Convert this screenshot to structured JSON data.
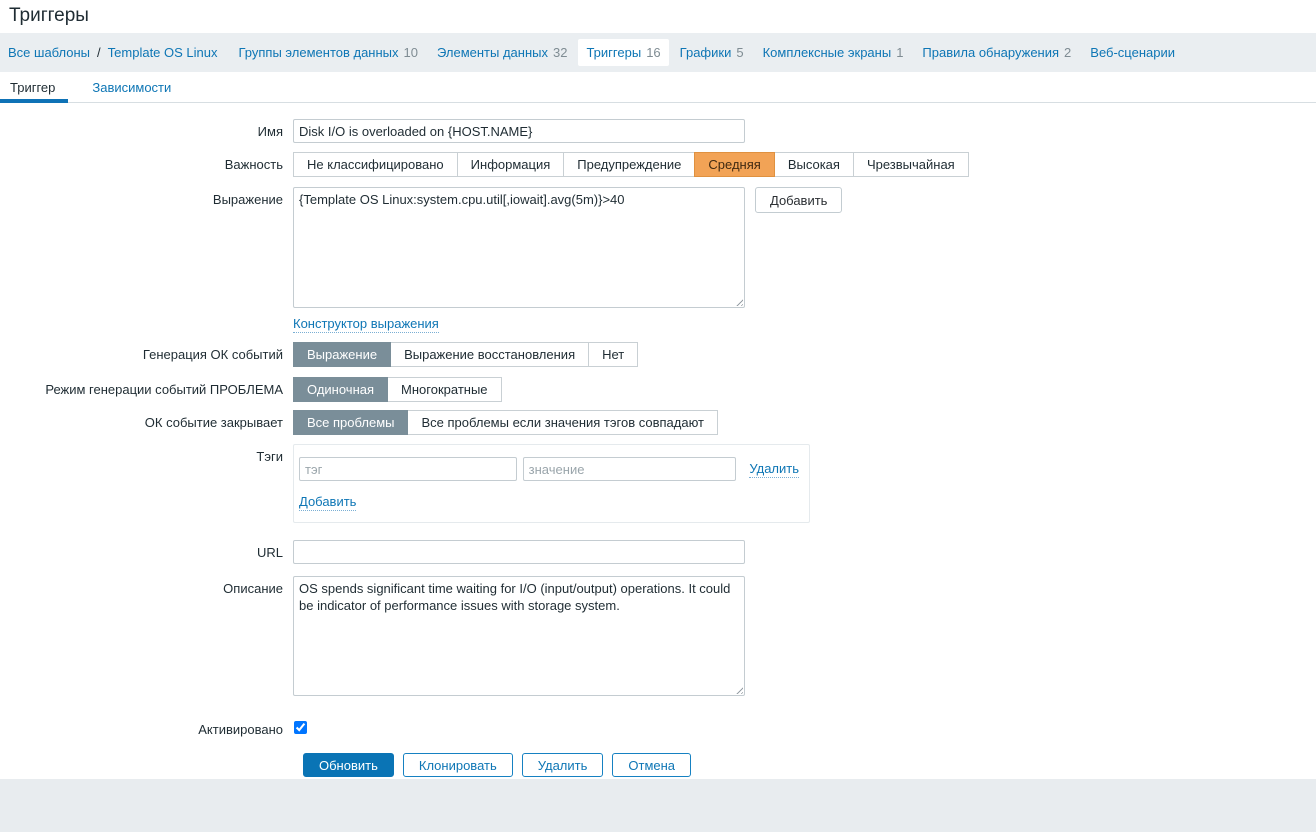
{
  "page_title": "Триггеры",
  "breadcrumb": {
    "root": "Все шаблоны",
    "separator": "/",
    "template": "Template OS Linux"
  },
  "nav": {
    "items": [
      {
        "label": "Группы элементов данных",
        "count": "10"
      },
      {
        "label": "Элементы данных",
        "count": "32"
      },
      {
        "label": "Триггеры",
        "count": "16",
        "selected": true
      },
      {
        "label": "Графики",
        "count": "5"
      },
      {
        "label": "Комплексные экраны",
        "count": "1"
      },
      {
        "label": "Правила обнаружения",
        "count": "2"
      },
      {
        "label": "Веб-сценарии",
        "count": ""
      }
    ]
  },
  "tabs": [
    {
      "label": "Триггер",
      "active": true
    },
    {
      "label": "Зависимости",
      "active": false
    }
  ],
  "form": {
    "name": {
      "label": "Имя",
      "value": "Disk I/O is overloaded on {HOST.NAME}"
    },
    "severity": {
      "label": "Важность",
      "options": [
        "Не классифицировано",
        "Информация",
        "Предупреждение",
        "Средняя",
        "Высокая",
        "Чрезвычайная"
      ],
      "selected": "Средняя"
    },
    "expression": {
      "label": "Выражение",
      "value": "{Template OS Linux:system.cpu.util[,iowait].avg(5m)}>40",
      "add_button": "Добавить",
      "constructor_link": "Конструктор выражения"
    },
    "ok_event_generation": {
      "label": "Генерация ОК событий",
      "options": [
        "Выражение",
        "Выражение восстановления",
        "Нет"
      ],
      "selected": "Выражение"
    },
    "problem_event_mode": {
      "label": "Режим генерации событий ПРОБЛЕМА",
      "options": [
        "Одиночная",
        "Многократные"
      ],
      "selected": "Одиночная"
    },
    "ok_event_closes": {
      "label": "ОК событие закрывает",
      "options": [
        "Все проблемы",
        "Все проблемы если значения тэгов совпадают"
      ],
      "selected": "Все проблемы"
    },
    "tags": {
      "label": "Тэги",
      "tag_placeholder": "тэг",
      "value_placeholder": "значение",
      "tag_value": "",
      "value_value": "",
      "remove_link": "Удалить",
      "add_link": "Добавить"
    },
    "url": {
      "label": "URL",
      "value": ""
    },
    "description": {
      "label": "Описание",
      "value": "OS spends significant time waiting for I/O (input/output) operations. It could be indicator of performance issues with storage system."
    },
    "enabled": {
      "label": "Активировано",
      "checked": true
    }
  },
  "footer": {
    "buttons": [
      {
        "label": "Обновить",
        "primary": true
      },
      {
        "label": "Клонировать",
        "primary": false
      },
      {
        "label": "Удалить",
        "primary": false
      },
      {
        "label": "Отмена",
        "primary": false
      }
    ]
  },
  "colors": {
    "link": "#0e76b5",
    "nav_bar_background": "#eaeef1",
    "severity_selected": "#f2a356",
    "segment_selected": "#7a8e99",
    "primary_button": "#0a74b5",
    "tab_underline": "#0e72b6",
    "body_background": "#e8ecef"
  }
}
